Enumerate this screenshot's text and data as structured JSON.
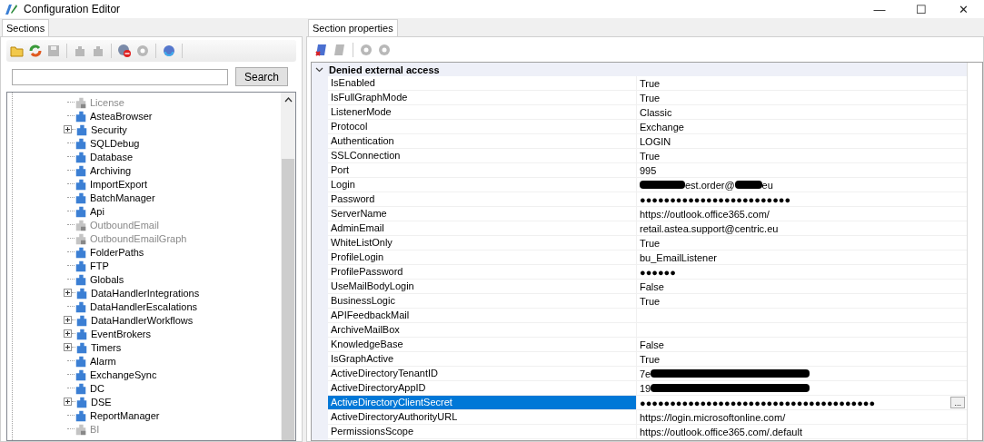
{
  "window": {
    "title": "Configuration Editor",
    "controls": [
      "—",
      "☐",
      "✕"
    ]
  },
  "sections_panel": {
    "tab": {
      "label": "Sections",
      "selected": true
    },
    "toolbar": [
      {
        "kind": "folder",
        "disabled": false
      },
      {
        "kind": "refresh",
        "disabled": false
      },
      {
        "kind": "save",
        "disabled": true
      },
      {
        "kind": "sep"
      },
      {
        "kind": "puzzle",
        "disabled": true
      },
      {
        "kind": "puzzle",
        "disabled": true
      },
      {
        "kind": "sep"
      },
      {
        "kind": "gear-remove",
        "disabled": false
      },
      {
        "kind": "gear",
        "disabled": true
      },
      {
        "kind": "sep"
      },
      {
        "kind": "gear-sync",
        "disabled": false
      },
      {
        "kind": "sep"
      }
    ],
    "search": {
      "button": "Search"
    },
    "tree": [
      {
        "label": "License",
        "disabled": true,
        "expandable": false
      },
      {
        "label": "AsteaBrowser",
        "disabled": false,
        "expandable": false
      },
      {
        "label": "Security",
        "disabled": false,
        "expandable": true
      },
      {
        "label": "SQLDebug",
        "disabled": false,
        "expandable": false
      },
      {
        "label": "Database",
        "disabled": false,
        "expandable": false
      },
      {
        "label": "Archiving",
        "disabled": false,
        "expandable": false
      },
      {
        "label": "ImportExport",
        "disabled": false,
        "expandable": false
      },
      {
        "label": "BatchManager",
        "disabled": false,
        "expandable": false
      },
      {
        "label": "Api",
        "disabled": false,
        "expandable": false
      },
      {
        "label": "OutboundEmail",
        "disabled": true,
        "expandable": false
      },
      {
        "label": "OutboundEmailGraph",
        "disabled": true,
        "expandable": false
      },
      {
        "label": "FolderPaths",
        "disabled": false,
        "expandable": false
      },
      {
        "label": "FTP",
        "disabled": false,
        "expandable": false
      },
      {
        "label": "Globals",
        "disabled": false,
        "expandable": false
      },
      {
        "label": "DataHandlerIntegrations",
        "disabled": false,
        "expandable": true
      },
      {
        "label": "DataHandlerEscalations",
        "disabled": false,
        "expandable": false
      },
      {
        "label": "DataHandlerWorkflows",
        "disabled": false,
        "expandable": true
      },
      {
        "label": "EventBrokers",
        "disabled": false,
        "expandable": true
      },
      {
        "label": "Timers",
        "disabled": false,
        "expandable": true
      },
      {
        "label": "Alarm",
        "disabled": false,
        "expandable": false
      },
      {
        "label": "ExchangeSync",
        "disabled": false,
        "expandable": false
      },
      {
        "label": "DC",
        "disabled": false,
        "expandable": false
      },
      {
        "label": "DSE",
        "disabled": false,
        "expandable": true
      },
      {
        "label": "ReportManager",
        "disabled": false,
        "expandable": false
      },
      {
        "label": "BI",
        "disabled": true,
        "expandable": false
      }
    ]
  },
  "properties_panel": {
    "tab": {
      "label": "Section properties",
      "selected": true
    },
    "toolbar": [
      {
        "kind": "script-remove",
        "disabled": false
      },
      {
        "kind": "script",
        "disabled": true
      },
      {
        "kind": "sep"
      },
      {
        "kind": "gear",
        "disabled": true
      },
      {
        "kind": "gear",
        "disabled": true
      }
    ],
    "category": {
      "title": "Denied external access",
      "expanded": true
    },
    "properties": [
      {
        "name": "IsEnabled",
        "value": [
          {
            "kind": "text",
            "text": "True"
          }
        ],
        "selected": false
      },
      {
        "name": "IsFullGraphMode",
        "value": [
          {
            "kind": "text",
            "text": "True"
          }
        ],
        "selected": false
      },
      {
        "name": "ListenerMode",
        "value": [
          {
            "kind": "text",
            "text": "Classic"
          }
        ],
        "selected": false
      },
      {
        "name": "Protocol",
        "value": [
          {
            "kind": "text",
            "text": "Exchange"
          }
        ],
        "selected": false
      },
      {
        "name": "Authentication",
        "value": [
          {
            "kind": "text",
            "text": "LOGIN"
          }
        ],
        "selected": false
      },
      {
        "name": "SSLConnection",
        "value": [
          {
            "kind": "text",
            "text": "True"
          }
        ],
        "selected": false
      },
      {
        "name": "Port",
        "value": [
          {
            "kind": "text",
            "text": "995"
          }
        ],
        "selected": false
      },
      {
        "name": "Login",
        "value": [
          {
            "kind": "redacted"
          },
          {
            "kind": "text",
            "text": "est.order@"
          },
          {
            "kind": "redacted"
          },
          {
            "kind": "text",
            "text": "eu"
          }
        ],
        "selected": false
      },
      {
        "name": "Password",
        "value": [
          {
            "kind": "text",
            "text": "●●●●●●●●●●●●●●●●●●●●●●●●●"
          }
        ],
        "selected": false
      },
      {
        "name": "ServerName",
        "value": [
          {
            "kind": "text",
            "text": "https://outlook.office365.com/"
          }
        ],
        "selected": false
      },
      {
        "name": "AdminEmail",
        "value": [
          {
            "kind": "text",
            "text": "retail.astea.support@centric.eu"
          }
        ],
        "selected": false
      },
      {
        "name": "WhiteListOnly",
        "value": [
          {
            "kind": "text",
            "text": "True"
          }
        ],
        "selected": false
      },
      {
        "name": "ProfileLogin",
        "value": [
          {
            "kind": "text",
            "text": "bu_EmailListener"
          }
        ],
        "selected": false
      },
      {
        "name": "ProfilePassword",
        "value": [
          {
            "kind": "text",
            "text": "●●●●●●"
          }
        ],
        "selected": false
      },
      {
        "name": "UseMailBodyLogin",
        "value": [
          {
            "kind": "text",
            "text": "False"
          }
        ],
        "selected": false
      },
      {
        "name": "BusinessLogic",
        "value": [
          {
            "kind": "text",
            "text": "True"
          }
        ],
        "selected": false
      },
      {
        "name": "APIFeedbackMail",
        "selected": false
      },
      {
        "name": "ArchiveMailBox",
        "selected": false
      },
      {
        "name": "KnowledgeBase",
        "value": [
          {
            "kind": "text",
            "text": "False"
          }
        ],
        "selected": false
      },
      {
        "name": "IsGraphActive",
        "value": [
          {
            "kind": "text",
            "text": "True"
          }
        ],
        "selected": false
      },
      {
        "name": "ActiveDirectoryTenantID",
        "value": [
          {
            "kind": "text",
            "text": "7e"
          },
          {
            "kind": "redacted"
          }
        ],
        "selected": false
      },
      {
        "name": "ActiveDirectoryAppID",
        "value": [
          {
            "kind": "text",
            "text": "19"
          },
          {
            "kind": "redacted"
          }
        ],
        "selected": false
      },
      {
        "name": "ActiveDirectoryClientSecret",
        "value": [
          {
            "kind": "text",
            "text": "●●●●●●●●●●●●●●●●●●●●●●●●●●●●●●●●●●●●●●●"
          }
        ],
        "selected": true,
        "ellipsis": "..."
      },
      {
        "name": "ActiveDirectoryAuthorityURL",
        "value": [
          {
            "kind": "text",
            "text": "https://login.microsoftonline.com/"
          }
        ],
        "selected": false
      },
      {
        "name": "PermissionsScope",
        "value": [
          {
            "kind": "text",
            "text": "https://outlook.office365.com/.default"
          }
        ],
        "selected": false
      }
    ]
  }
}
